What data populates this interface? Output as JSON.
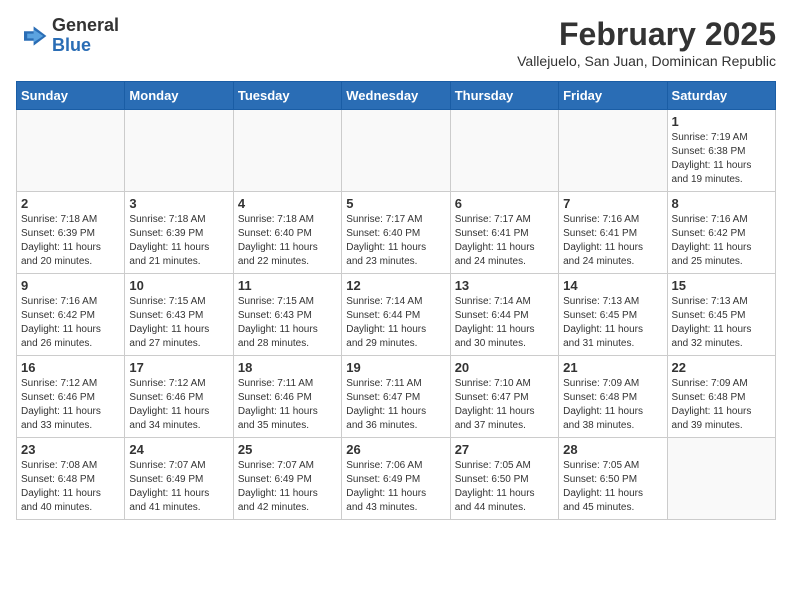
{
  "logo": {
    "general": "General",
    "blue": "Blue"
  },
  "title": {
    "month_year": "February 2025",
    "location": "Vallejuelo, San Juan, Dominican Republic"
  },
  "weekdays": [
    "Sunday",
    "Monday",
    "Tuesday",
    "Wednesday",
    "Thursday",
    "Friday",
    "Saturday"
  ],
  "weeks": [
    [
      {
        "day": "",
        "info": ""
      },
      {
        "day": "",
        "info": ""
      },
      {
        "day": "",
        "info": ""
      },
      {
        "day": "",
        "info": ""
      },
      {
        "day": "",
        "info": ""
      },
      {
        "day": "",
        "info": ""
      },
      {
        "day": "1",
        "info": "Sunrise: 7:19 AM\nSunset: 6:38 PM\nDaylight: 11 hours\nand 19 minutes."
      }
    ],
    [
      {
        "day": "2",
        "info": "Sunrise: 7:18 AM\nSunset: 6:39 PM\nDaylight: 11 hours\nand 20 minutes."
      },
      {
        "day": "3",
        "info": "Sunrise: 7:18 AM\nSunset: 6:39 PM\nDaylight: 11 hours\nand 21 minutes."
      },
      {
        "day": "4",
        "info": "Sunrise: 7:18 AM\nSunset: 6:40 PM\nDaylight: 11 hours\nand 22 minutes."
      },
      {
        "day": "5",
        "info": "Sunrise: 7:17 AM\nSunset: 6:40 PM\nDaylight: 11 hours\nand 23 minutes."
      },
      {
        "day": "6",
        "info": "Sunrise: 7:17 AM\nSunset: 6:41 PM\nDaylight: 11 hours\nand 24 minutes."
      },
      {
        "day": "7",
        "info": "Sunrise: 7:16 AM\nSunset: 6:41 PM\nDaylight: 11 hours\nand 24 minutes."
      },
      {
        "day": "8",
        "info": "Sunrise: 7:16 AM\nSunset: 6:42 PM\nDaylight: 11 hours\nand 25 minutes."
      }
    ],
    [
      {
        "day": "9",
        "info": "Sunrise: 7:16 AM\nSunset: 6:42 PM\nDaylight: 11 hours\nand 26 minutes."
      },
      {
        "day": "10",
        "info": "Sunrise: 7:15 AM\nSunset: 6:43 PM\nDaylight: 11 hours\nand 27 minutes."
      },
      {
        "day": "11",
        "info": "Sunrise: 7:15 AM\nSunset: 6:43 PM\nDaylight: 11 hours\nand 28 minutes."
      },
      {
        "day": "12",
        "info": "Sunrise: 7:14 AM\nSunset: 6:44 PM\nDaylight: 11 hours\nand 29 minutes."
      },
      {
        "day": "13",
        "info": "Sunrise: 7:14 AM\nSunset: 6:44 PM\nDaylight: 11 hours\nand 30 minutes."
      },
      {
        "day": "14",
        "info": "Sunrise: 7:13 AM\nSunset: 6:45 PM\nDaylight: 11 hours\nand 31 minutes."
      },
      {
        "day": "15",
        "info": "Sunrise: 7:13 AM\nSunset: 6:45 PM\nDaylight: 11 hours\nand 32 minutes."
      }
    ],
    [
      {
        "day": "16",
        "info": "Sunrise: 7:12 AM\nSunset: 6:46 PM\nDaylight: 11 hours\nand 33 minutes."
      },
      {
        "day": "17",
        "info": "Sunrise: 7:12 AM\nSunset: 6:46 PM\nDaylight: 11 hours\nand 34 minutes."
      },
      {
        "day": "18",
        "info": "Sunrise: 7:11 AM\nSunset: 6:46 PM\nDaylight: 11 hours\nand 35 minutes."
      },
      {
        "day": "19",
        "info": "Sunrise: 7:11 AM\nSunset: 6:47 PM\nDaylight: 11 hours\nand 36 minutes."
      },
      {
        "day": "20",
        "info": "Sunrise: 7:10 AM\nSunset: 6:47 PM\nDaylight: 11 hours\nand 37 minutes."
      },
      {
        "day": "21",
        "info": "Sunrise: 7:09 AM\nSunset: 6:48 PM\nDaylight: 11 hours\nand 38 minutes."
      },
      {
        "day": "22",
        "info": "Sunrise: 7:09 AM\nSunset: 6:48 PM\nDaylight: 11 hours\nand 39 minutes."
      }
    ],
    [
      {
        "day": "23",
        "info": "Sunrise: 7:08 AM\nSunset: 6:48 PM\nDaylight: 11 hours\nand 40 minutes."
      },
      {
        "day": "24",
        "info": "Sunrise: 7:07 AM\nSunset: 6:49 PM\nDaylight: 11 hours\nand 41 minutes."
      },
      {
        "day": "25",
        "info": "Sunrise: 7:07 AM\nSunset: 6:49 PM\nDaylight: 11 hours\nand 42 minutes."
      },
      {
        "day": "26",
        "info": "Sunrise: 7:06 AM\nSunset: 6:49 PM\nDaylight: 11 hours\nand 43 minutes."
      },
      {
        "day": "27",
        "info": "Sunrise: 7:05 AM\nSunset: 6:50 PM\nDaylight: 11 hours\nand 44 minutes."
      },
      {
        "day": "28",
        "info": "Sunrise: 7:05 AM\nSunset: 6:50 PM\nDaylight: 11 hours\nand 45 minutes."
      },
      {
        "day": "",
        "info": ""
      }
    ]
  ]
}
